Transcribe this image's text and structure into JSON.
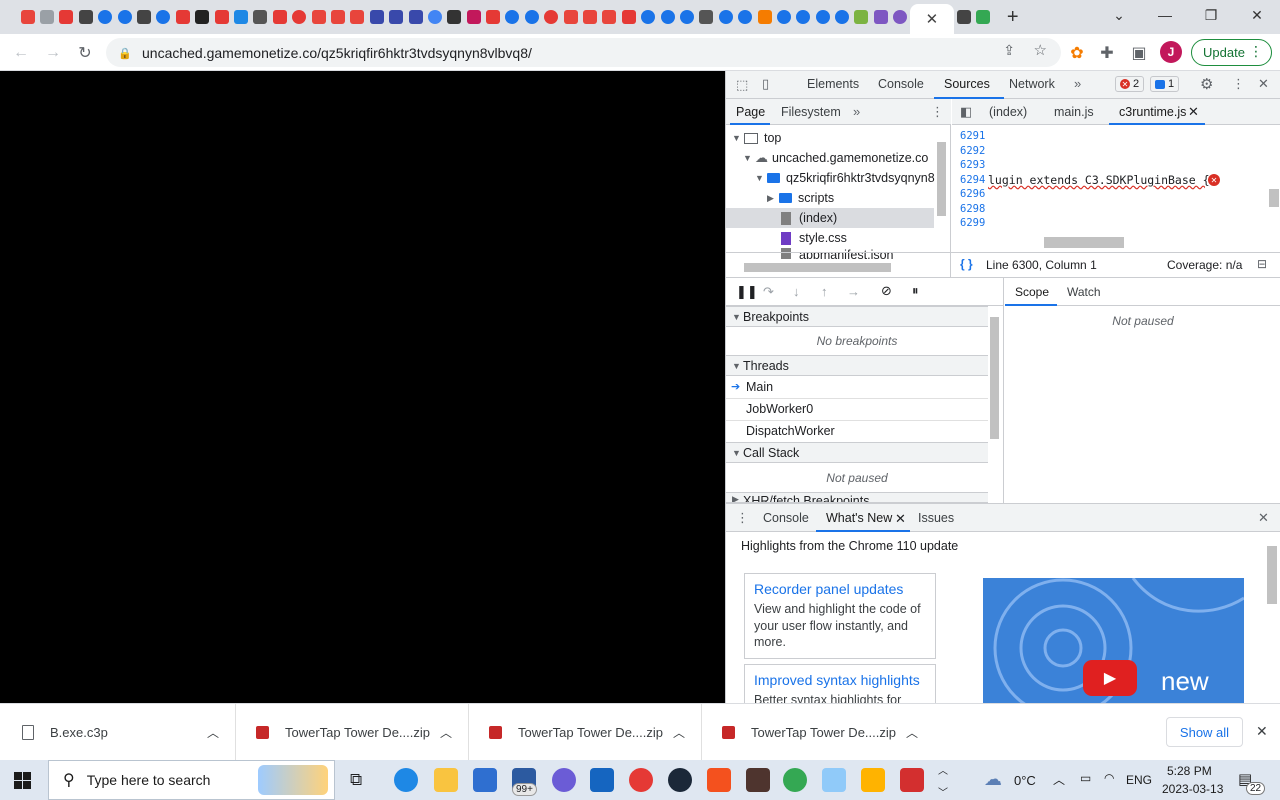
{
  "browser": {
    "active_tab_close": "✕",
    "new_tab": "+",
    "url": "uncached.gamemonetize.co/qz5kriqfir6hktr3tvdsyqnyn8vlbvq8/",
    "update_label": "Update",
    "avatar_letter": "J"
  },
  "devtools": {
    "tabs": [
      "Elements",
      "Console",
      "Sources",
      "Network"
    ],
    "error_count": "2",
    "message_count": "1",
    "nav_tabs": [
      "Page",
      "Filesystem"
    ],
    "tree": {
      "top": "top",
      "domain": "uncached.gamemonetize.co",
      "folder": "qz5kriqfir6hktr3tvdsyqnyn8",
      "scripts": "scripts",
      "index": "(index)",
      "style": "style.css",
      "manifest": "appmanifest.json"
    },
    "editor_tabs": [
      "(index)",
      "main.js",
      "c3runtime.js"
    ],
    "line_numbers": [
      "6291",
      "6292",
      "6293",
      "6294",
      "6296",
      "6298",
      "6299"
    ],
    "code_line": "lugin extends C3.SDKPluginBase {",
    "status_position": "Line 6300, Column 1",
    "status_coverage": "Coverage: n/a",
    "debug": {
      "breakpoints_header": "Breakpoints",
      "no_breakpoints": "No breakpoints",
      "threads_header": "Threads",
      "threads": [
        "Main",
        "JobWorker0",
        "DispatchWorker"
      ],
      "callstack_header": "Call Stack",
      "not_paused": "Not paused",
      "xhr_header": "XHR/fetch Breakpoints"
    },
    "scope_tabs": [
      "Scope",
      "Watch"
    ],
    "scope_not_paused": "Not paused",
    "drawer_tabs": [
      "Console",
      "What's New",
      "Issues"
    ],
    "whats_new_title": "Highlights from the Chrome 110 update",
    "cards": [
      {
        "title": "Recorder panel updates",
        "body": "View and highlight the code of your user flow instantly, and more."
      },
      {
        "title": "Improved syntax highlights",
        "body": "Better syntax highlights for"
      }
    ],
    "promo_text": "new"
  },
  "downloads": {
    "items": [
      {
        "name": "B.exe.c3p"
      },
      {
        "name": "TowerTap Tower De....zip"
      },
      {
        "name": "TowerTap Tower De....zip"
      },
      {
        "name": "TowerTap Tower De....zip"
      }
    ],
    "show_all": "Show all"
  },
  "taskbar": {
    "search_placeholder": "Type here to search",
    "mail_badge": "99+",
    "weather": "0°C",
    "language": "ENG",
    "time": "5:28 PM",
    "date": "2023-03-13",
    "notifications": "22"
  },
  "colors": {
    "accent": "#1a73e8",
    "update_green": "#137333",
    "error_red": "#d93025"
  }
}
